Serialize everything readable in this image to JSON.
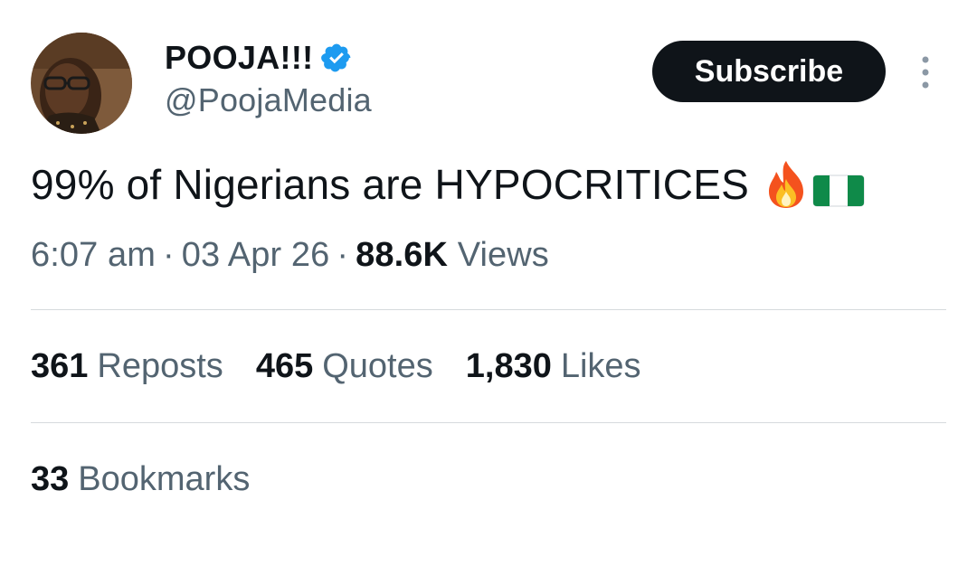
{
  "author": {
    "display_name": "POOJA!!!",
    "handle": "@PoojaMedia",
    "avatar_icon": "profile-photo",
    "verified_icon": "verified-badge-icon",
    "verified_color": "#1d9bf0"
  },
  "actions": {
    "subscribe_label": "Subscribe",
    "more_icon": "more-vertical-icon"
  },
  "tweet": {
    "text": "99% of Nigerians are HYPOCRITICES",
    "emojis": [
      "fire-icon",
      "nigeria-flag-icon"
    ]
  },
  "meta": {
    "time": "6:07 am",
    "separator": "·",
    "date": "03 Apr 26",
    "views_count": "88.6K",
    "views_label": "Views"
  },
  "stats": {
    "reposts_count": "361",
    "reposts_label": "Reposts",
    "quotes_count": "465",
    "quotes_label": "Quotes",
    "likes_count": "1,830",
    "likes_label": "Likes",
    "bookmarks_count": "33",
    "bookmarks_label": "Bookmarks"
  },
  "colors": {
    "text_primary": "#0f1419",
    "text_secondary": "#536471",
    "button_bg": "#0f1419",
    "divider": "#d6dadd"
  }
}
